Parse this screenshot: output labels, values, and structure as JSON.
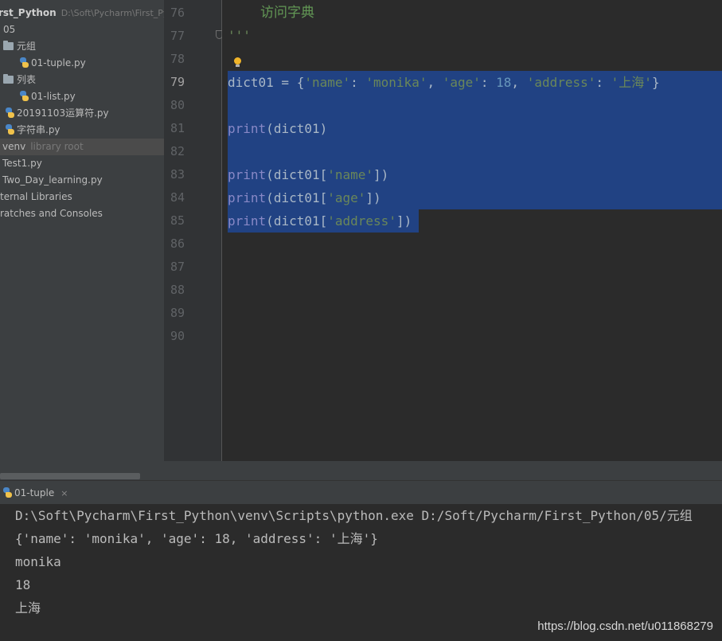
{
  "sidebar": {
    "project_name": "rst_Python",
    "project_path": "D:\\Soft\\Pycharm\\First_Py",
    "items": [
      {
        "label": "05",
        "icon": "none"
      },
      {
        "label": "元组",
        "icon": "folder-icon"
      },
      {
        "label": "01-tuple.py",
        "icon": "python-file-icon"
      },
      {
        "label": "列表",
        "icon": "folder-icon"
      },
      {
        "label": "01-list.py",
        "icon": "python-file-icon"
      },
      {
        "label": "20191103运算符.py",
        "icon": "python-file-icon"
      },
      {
        "label": "字符串.py",
        "icon": "python-file-icon"
      },
      {
        "label": "venv",
        "hint": "library root",
        "selected": true
      },
      {
        "label": "Test1.py",
        "icon": "python-file-icon"
      },
      {
        "label": "Two_Day_learning.py",
        "icon": "python-file-icon"
      },
      {
        "label": "ternal Libraries"
      },
      {
        "label": "ratches and Consoles"
      }
    ]
  },
  "editor": {
    "line_numbers": [
      "76",
      "77",
      "78",
      "79",
      "80",
      "81",
      "82",
      "83",
      "84",
      "85",
      "86",
      "87",
      "88",
      "89",
      "90"
    ],
    "current_line": "79",
    "comment_line": "访问字典",
    "docstring_end": "'''",
    "dict_var": "dict01",
    "dict_keys": [
      "'name'",
      "'age'",
      "'address'"
    ],
    "dict_values": [
      "'monika'",
      "18",
      "'上海'"
    ],
    "print_kw": "print"
  },
  "run_panel": {
    "tab_label": "01-tuple",
    "close_glyph": "×",
    "console_lines": [
      "D:\\Soft\\Pycharm\\First_Python\\venv\\Scripts\\python.exe D:/Soft/Pycharm/First_Python/05/元组",
      "{'name': 'monika', 'age': 18, 'address': '上海'}",
      "monika",
      "18",
      "上海"
    ]
  },
  "watermark": "https://blog.csdn.net/u011868279",
  "colors": {
    "selection": "#214283",
    "string": "#6a8759",
    "number": "#6897bb",
    "builtin": "#8888c6",
    "code_text": "#a9b7c6",
    "comment": "#629755"
  }
}
